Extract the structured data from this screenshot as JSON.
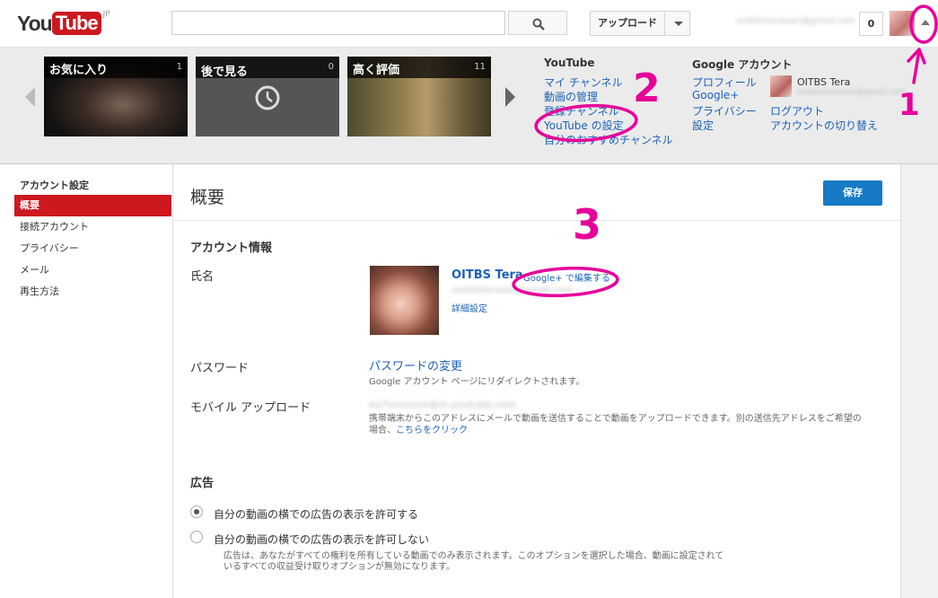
{
  "header": {
    "logo_you": "You",
    "logo_tube": "Tube",
    "logo_region": "JP",
    "search_placeholder": "",
    "upload_label": "アップロード",
    "user_email": "outbitsterasan@gmail.com",
    "notification_count": "0"
  },
  "guide": {
    "playlists": [
      {
        "label": "お気に入り",
        "count": "1"
      },
      {
        "label": "後で見る",
        "count": "0"
      },
      {
        "label": "高く評価",
        "count": "11"
      }
    ],
    "youtube_menu": {
      "heading": "YouTube",
      "items": [
        "マイ チャンネル",
        "動画の管理",
        "登録チャンネル",
        "YouTube の設定",
        "自分のおすすめチャンネル"
      ]
    },
    "google_menu": {
      "heading": "Google アカウント",
      "items": [
        "プロフィール",
        "Google+",
        "プライバシー",
        "設定"
      ],
      "account_name": "OITBS Tera",
      "account_email": "outbitsterasan@gmail.com",
      "logout": "ログアウト",
      "switch_account": "アカウントの切り替え"
    }
  },
  "leftnav": {
    "heading": "アカウント設定",
    "items": [
      "概要",
      "接続アカウント",
      "プライバシー",
      "メール",
      "再生方法"
    ]
  },
  "main": {
    "title": "概要",
    "save_label": "保存",
    "account_section": "アカウント情報",
    "name_label": "氏名",
    "profile_name": "OITBS Tera",
    "gplus_edit": "Google+ で編集する",
    "profile_email": "outbitsterasan@gmail.com",
    "detail_settings": "詳細設定",
    "password_label": "パスワード",
    "password_link": "パスワードの変更",
    "password_note": "Google アカウント ページにリダイレクトされます。",
    "mobile_label": "モバイル アップロード",
    "mobile_address": "eq7xxxxxxx@m.youtube.com",
    "mobile_note": "携帯端末からこのアドレスにメールで動画を送信することで動画をアップロードできます。別の送信先アドレスをご希望の場合、",
    "mobile_link": "こちらをクリック",
    "ads_section": "広告",
    "ads_allow": "自分の動画の横での広告の表示を許可する",
    "ads_deny": "自分の動画の横での広告の表示を許可しない",
    "ads_note": "広告は、あなたがすべての権利を所有している動画でのみ表示されます。このオプションを選択した場合、動画に設定されているすべての収益受け取りオプションが無効になります。"
  },
  "annotations": {
    "color": "#e6009a",
    "marks": [
      "1",
      "2",
      "3"
    ]
  }
}
